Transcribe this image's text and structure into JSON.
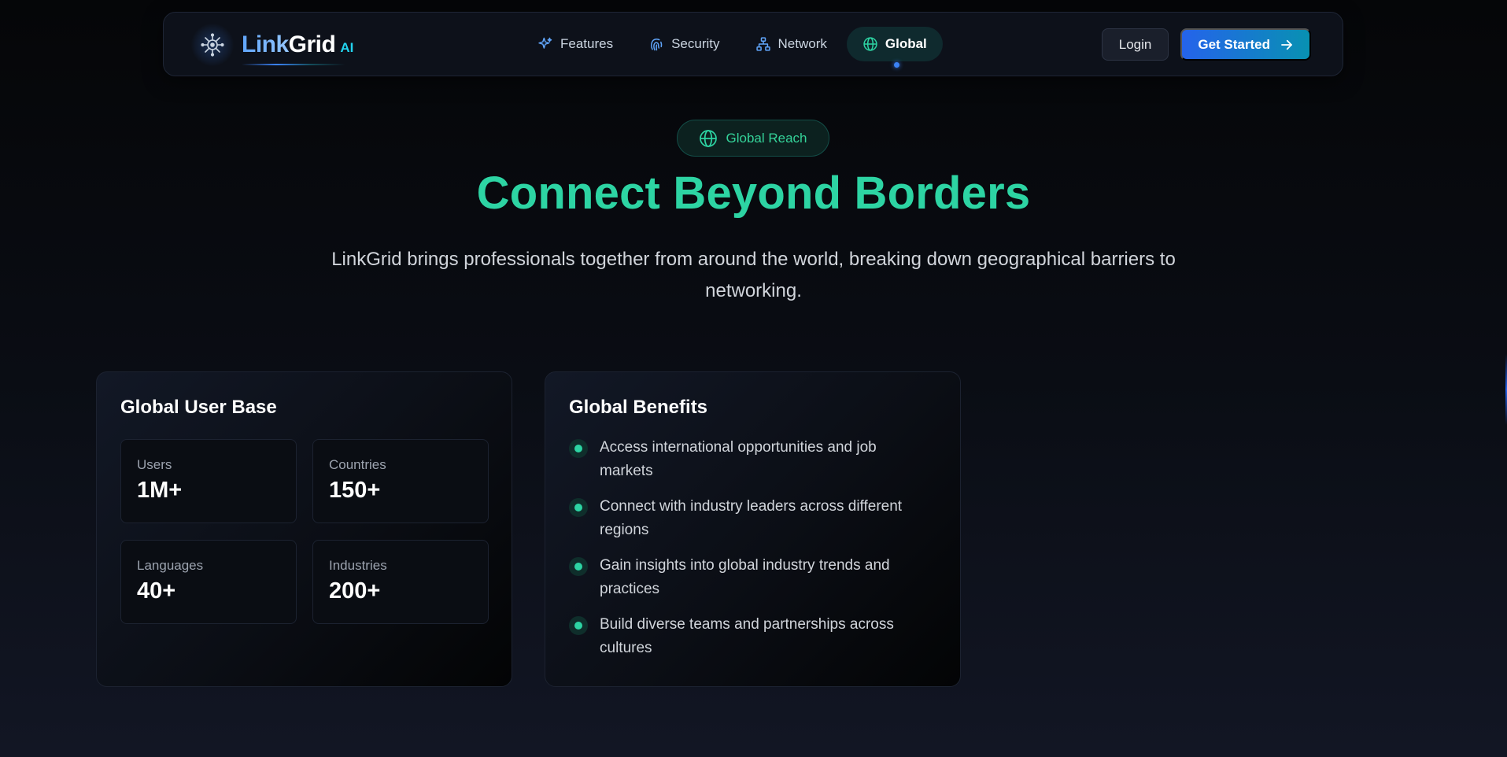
{
  "brand": {
    "name_part1": "Link",
    "name_part2": "Grid",
    "suffix": "AI",
    "logo_icon": "brain-chip-icon"
  },
  "nav": {
    "items": [
      {
        "label": "Features",
        "icon": "sparkles-icon",
        "active": false
      },
      {
        "label": "Security",
        "icon": "fingerprint-icon",
        "active": false
      },
      {
        "label": "Network",
        "icon": "network-icon",
        "active": false
      },
      {
        "label": "Global",
        "icon": "globe-icon",
        "active": true
      }
    ],
    "login_label": "Login",
    "get_started_label": "Get Started",
    "get_started_icon": "arrow-right-icon"
  },
  "hero": {
    "badge_label": "Global Reach",
    "badge_icon": "globe-icon",
    "title": "Connect Beyond Borders",
    "subtitle": "LinkGrid brings professionals together from around the world, breaking down geographical barriers to networking."
  },
  "user_base": {
    "title": "Global User Base",
    "stats": [
      {
        "label": "Users",
        "value": "1M+"
      },
      {
        "label": "Countries",
        "value": "150+"
      },
      {
        "label": "Languages",
        "value": "40+"
      },
      {
        "label": "Industries",
        "value": "200+"
      }
    ]
  },
  "benefits": {
    "title": "Global Benefits",
    "items": [
      "Access international opportunities and job markets",
      "Connect with industry leaders across different regions",
      "Gain insights into global industry trends and practices",
      "Build diverse teams and partnerships across cultures"
    ]
  },
  "colors": {
    "accent_teal": "#2dd4a3",
    "accent_blue": "#3b82f6",
    "cyan": "#22d3ee",
    "background": "#050608"
  }
}
